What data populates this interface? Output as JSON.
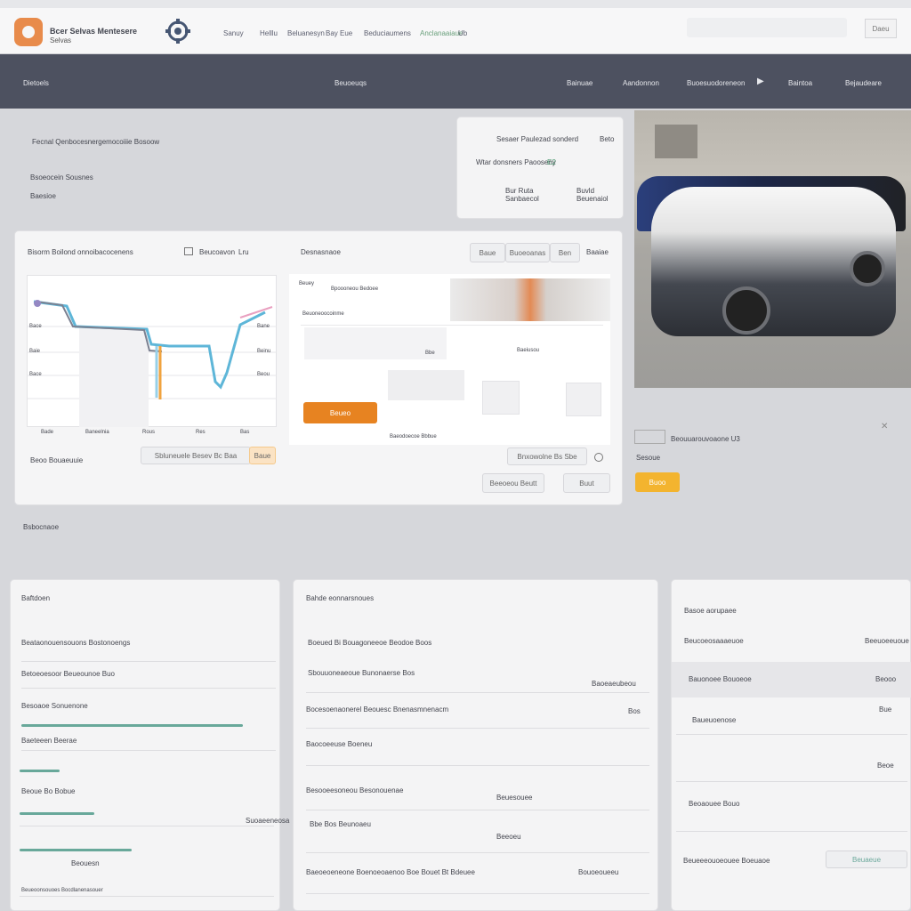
{
  "window": {
    "title": "Bcer Selvas Mentesere",
    "subtitle": "Selvas"
  },
  "header": {
    "nav": [
      "Sanuy",
      "Helllu",
      "Beluanesyn",
      "Bay Eue",
      "Beduciaumens",
      "Anclanaaiaue",
      "Ub"
    ],
    "search_placeholder": "",
    "button_label": "Daeu"
  },
  "navbar": {
    "left": "Dietoels",
    "center": "Beuoeuqs",
    "items": [
      "Bainuae",
      "Aandonnon",
      "Buoesuodoreneon",
      "Baintoa",
      "Bejaudeare"
    ]
  },
  "hero": {
    "title": "Fecnal Qenbocesnergemocoiiie Bosoow",
    "line1": "Bsoeocein Sousnes",
    "line2": "Baesioe",
    "info_card": {
      "title": "Sesaer Paulezad sonderd",
      "value": "Beto",
      "line": "Wtar donsners Paooseny",
      "badge": "E2",
      "stat1_value": "Bur Ruta",
      "stat1_label": "Sanbaecol",
      "stat2_value": "Buvld",
      "stat2_label": "Beuenaiol"
    }
  },
  "analytics": {
    "title": "Bisorm Boilond onnoibacocenens",
    "filter_icon": "filter-icon",
    "range": "Beucoavon",
    "unit": "Lru",
    "chart_labels": [
      "Bade",
      "Baneelnia",
      "Rous",
      "Res",
      "Bas"
    ],
    "chart_ticks_y": [
      "Bace",
      "Baie",
      "Bace"
    ],
    "chart_ticks_y2": [
      "Bane",
      "Beinu",
      "Beou"
    ],
    "footer_label": "Beoo Bouaeuuie",
    "pill_text": "Sbluneuele  Besev Bc  Baa",
    "pill_badge": "Baue",
    "panel2_title": "Desnasnaoe",
    "toggle_left": "Baue",
    "toggle_mid": "Buoeoanas",
    "toggle_right": "Ben",
    "toggle_last": "Baaiae",
    "doc_title": "Beuey",
    "doc_subtitle": "Bpoooneou Bedoee",
    "doc_row": "Beuoneoocoinme",
    "doc_labels": [
      "Bbe",
      "Baeiusou",
      "Baeodoecoe Bbbue"
    ],
    "doc_button": "Beueo",
    "bottom_pill": "Bnxowolne Bs  Sbe",
    "btn1": "Beeoeou Beutt",
    "btn2": "Buut"
  },
  "car_panel": {
    "caption": "Beouuarouvoaone  U3",
    "sub": "Sesoue",
    "button": "Buoo"
  },
  "section_label": "Bsbocnaoe",
  "list1": {
    "title": "Baftdoen",
    "rows": [
      {
        "label": "Beataonouensouons Bostonoengs",
        "value": ""
      },
      {
        "label": "Betoeoesoor Beueounoe Buo",
        "value": ""
      },
      {
        "label": "Besoaoe Sonuenone",
        "value": ""
      },
      {
        "label": "Baeteeen Beerae",
        "value": ""
      },
      {
        "label": "Beoue Bo Bobue",
        "value": ""
      },
      {
        "label": "Suoaeeneosa",
        "value": ""
      },
      {
        "label": "Beouesn",
        "value": ""
      },
      {
        "label": "Beueoonsouoes Bocdlanenasouer",
        "value": ""
      }
    ],
    "progress": [
      0.83,
      0.15,
      0.28,
      0.42
    ]
  },
  "list2": {
    "title": "Bahde eonnarsnoues",
    "rows": [
      {
        "label": "Boeued Bi Bouagoneeoe Beodoe Boos",
        "value": ""
      },
      {
        "label": "Sbouuoneaeoue Bunonaerse Bos",
        "value": "Baoeaeubeou"
      },
      {
        "label": "Bocesoenaonerel Beouesc Bnenasmnenacm",
        "value": "Bos"
      },
      {
        "label": "Baocoeeuse Boeneu",
        "value": ""
      },
      {
        "label": "Besooeesoneou Besonouenae",
        "value": "Beuesouee"
      },
      {
        "label": "Bbe  Bos  Beunoaeu",
        "value": "Beeoeu"
      },
      {
        "label": "Baeoeoeneone Boenoeoaenoo Boe Bouet Bt Bdeuee",
        "value": "Bouoeoueeu"
      }
    ]
  },
  "list3": {
    "title": "Basoe aorupaee",
    "rows": [
      {
        "label": "Beucoeosaaaeuoe",
        "value": "Beeuoeeuoue"
      },
      {
        "label": "Bauonoee Bouoeoe",
        "value": "Beooo"
      },
      {
        "label": "Baueuoenose",
        "value": "Bue"
      },
      {
        "label": "",
        "value": "Beoe"
      },
      {
        "label": "Beoaouee Bouo",
        "value": ""
      },
      {
        "label": "Beueeeouoeouee Boeuaoe",
        "value": "Beuaeue"
      }
    ]
  },
  "colors": {
    "nav_bg": "#4d5160",
    "accent_orange": "#e78321",
    "accent_yellow": "#f3b42f",
    "chart_blue": "#3aa9d4",
    "chart_teal": "#6ba89b"
  }
}
